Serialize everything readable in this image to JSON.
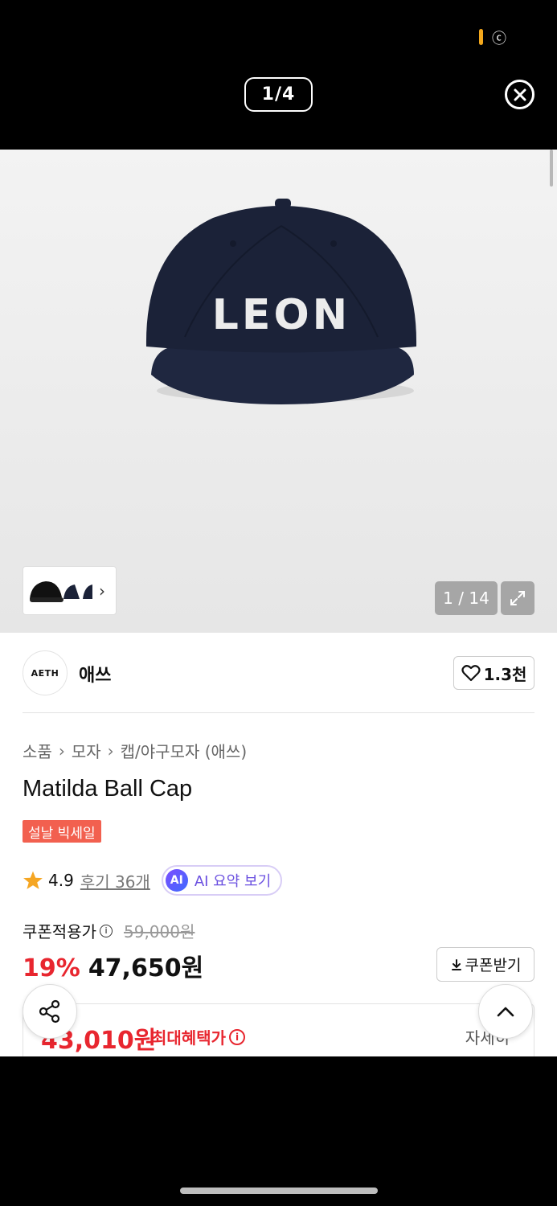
{
  "viewer": {
    "counter": "1/4",
    "status_glyph": "ⓒ"
  },
  "gallery": {
    "slide_counter": "1 / 14",
    "cap_logo_text": "LEON"
  },
  "brand": {
    "logo_text": "AETH",
    "name": "애쓰",
    "likes": "1.3천"
  },
  "breadcrumb": [
    "소품",
    "모자",
    "캡/야구모자 (애쓰)"
  ],
  "product": {
    "title": "Matilda Ball Cap",
    "sale_badge": "설날 빅세일",
    "rating": "4.9",
    "reviews": "후기 36개",
    "ai_badge": "AI",
    "ai_summary": "AI 요약 보기"
  },
  "price": {
    "coupon_label": "쿠폰적용가",
    "original": "59,000원",
    "discount": "19%",
    "final": "47,650원",
    "coupon_button": "쿠폰받기"
  },
  "benefit": {
    "price": "43,010원",
    "label": "최대혜택가",
    "detail": "자세히"
  },
  "colors": {
    "accent_red": "#e8262f",
    "badge_red": "#f2604f",
    "ai_purple": "#6a4fe0",
    "cap_navy": "#1b2238"
  }
}
